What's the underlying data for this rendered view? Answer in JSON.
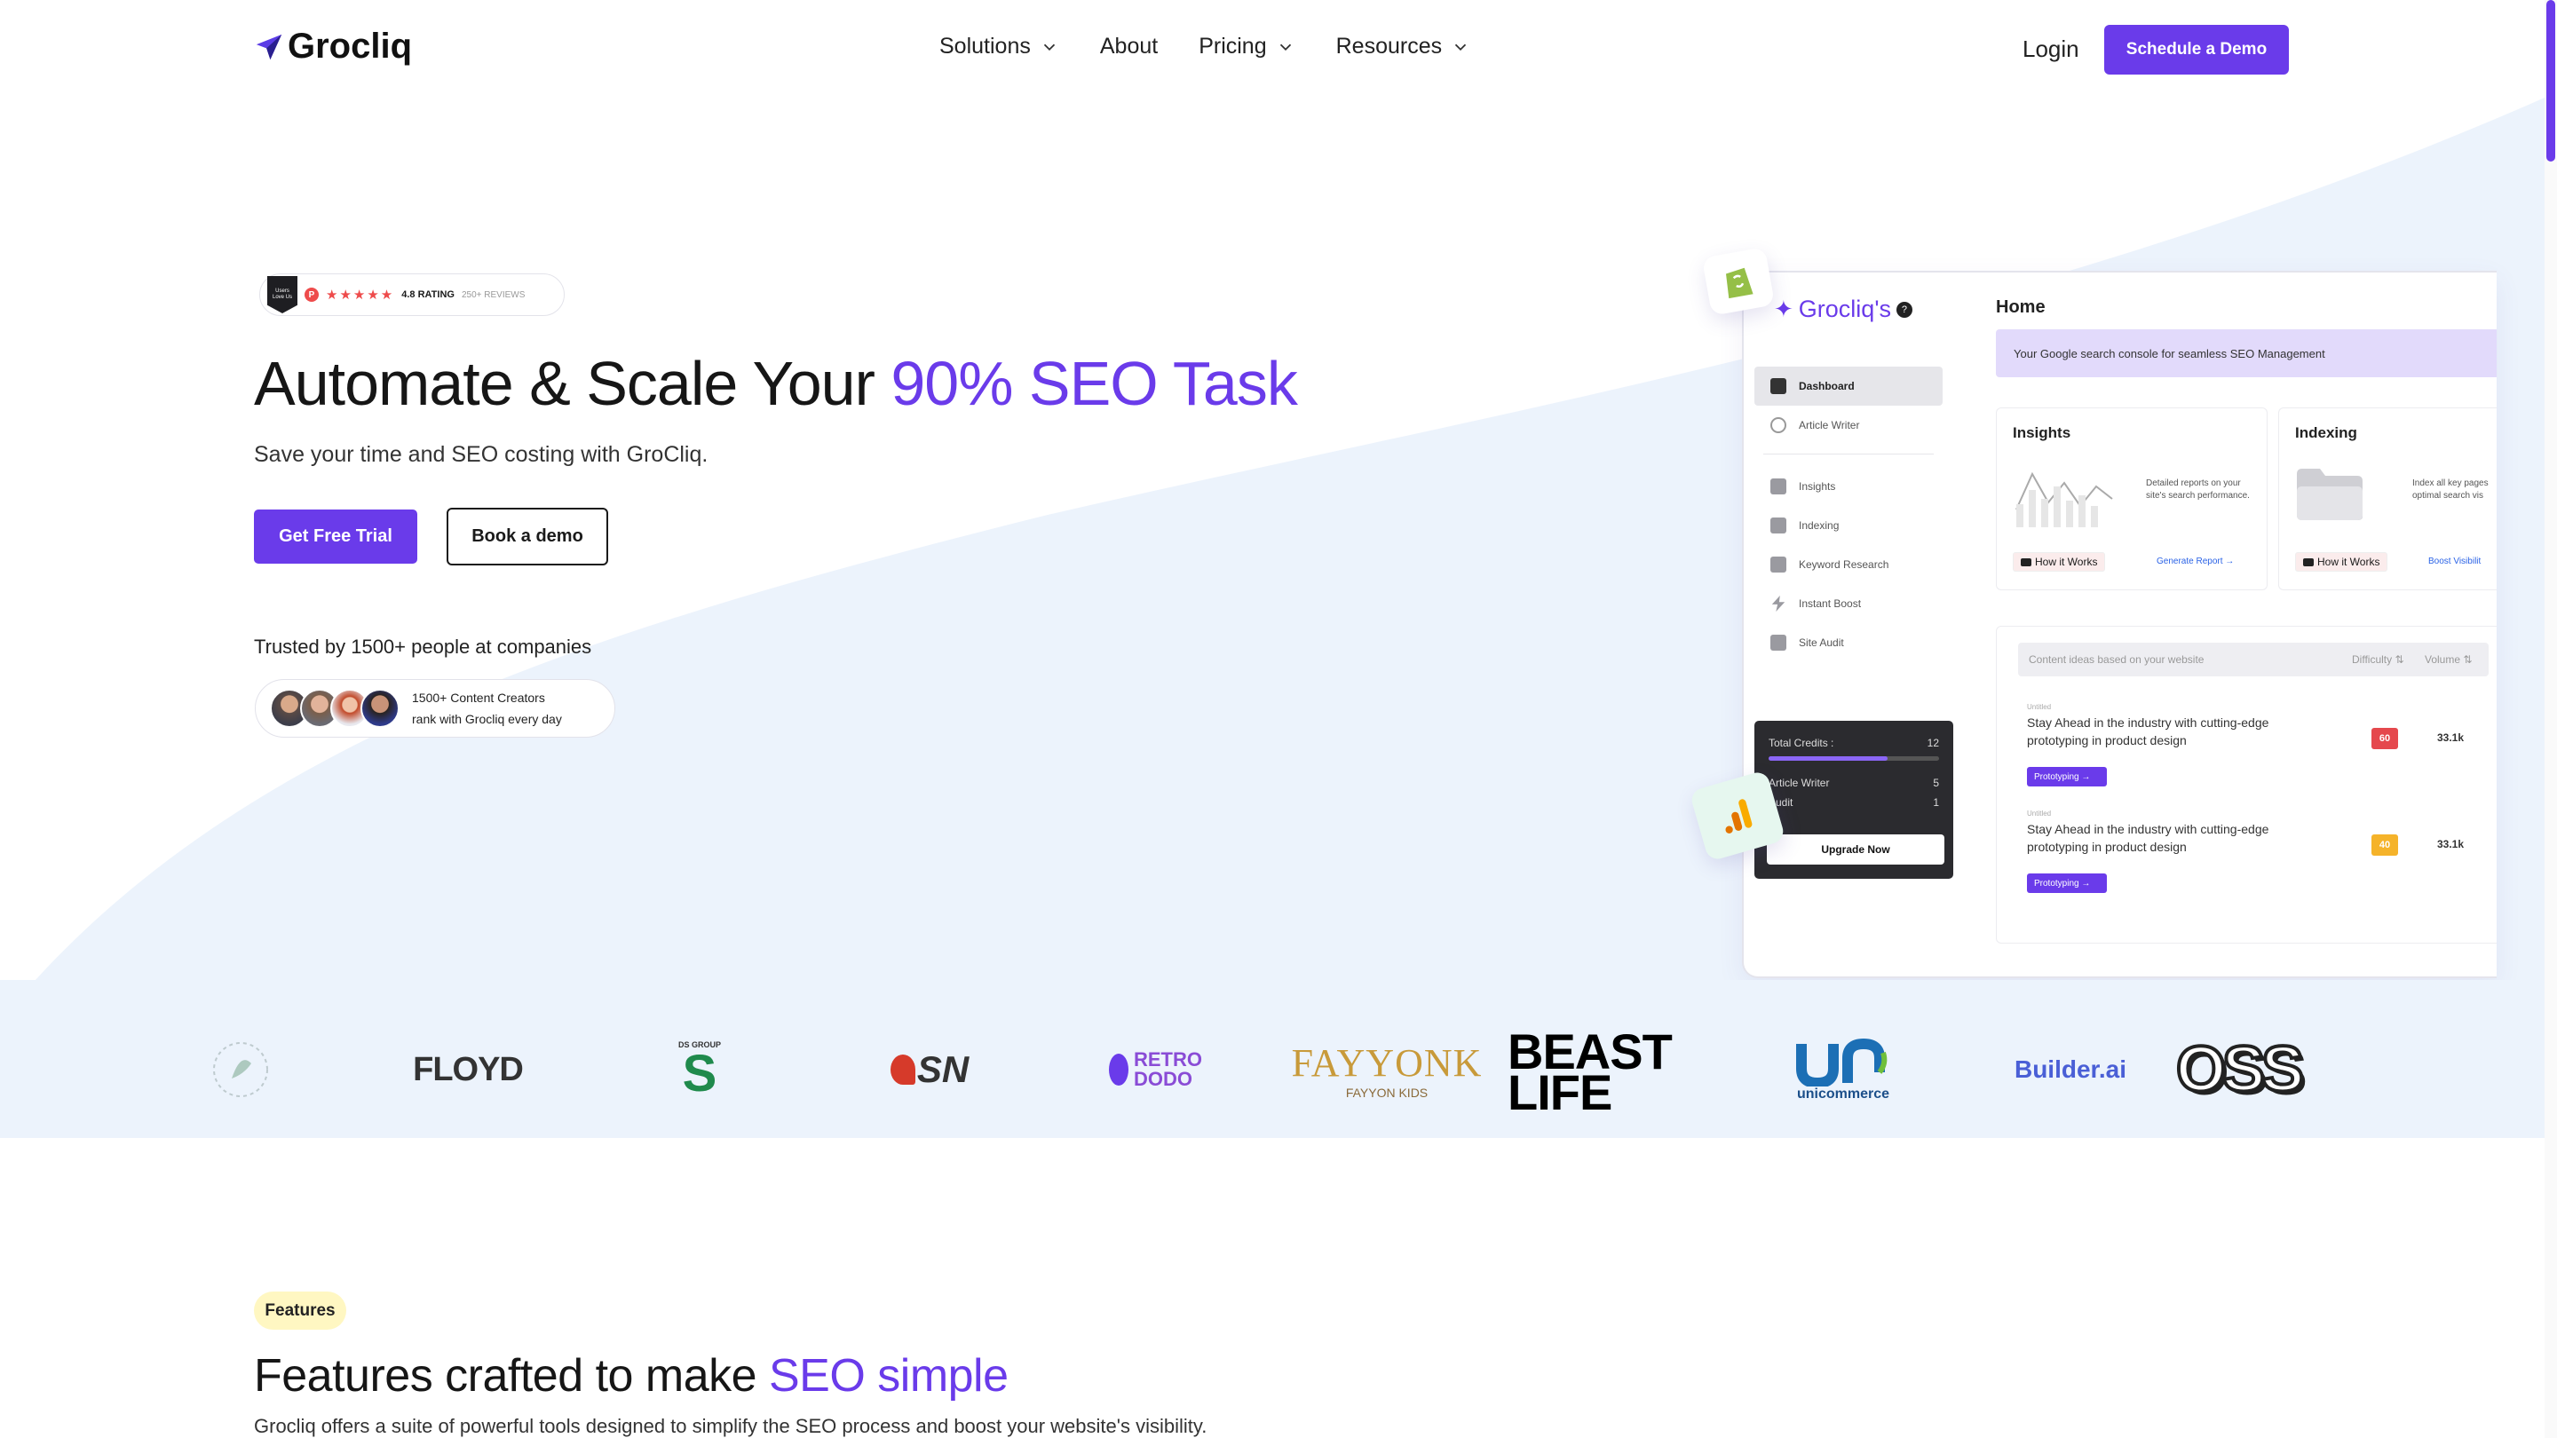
{
  "brand": {
    "name": "Grocliq",
    "accent": "#6a3bea"
  },
  "nav": {
    "items": [
      {
        "label": "Solutions",
        "dropdown": true
      },
      {
        "label": "About",
        "dropdown": false
      },
      {
        "label": "Pricing",
        "dropdown": true
      },
      {
        "label": "Resources",
        "dropdown": true
      }
    ],
    "login": "Login",
    "cta": "Schedule a Demo"
  },
  "hero": {
    "badge": {
      "shield_text": "Users Love Us",
      "rating": "4.8 RATING",
      "reviews": "250+ REVIEWS"
    },
    "title_prefix": "Automate & Scale Your ",
    "title_accent": "90% SEO Task",
    "subtitle": "Save your time and SEO costing with GroCliq.",
    "primary_button": "Get Free Trial",
    "secondary_button": "Book a demo",
    "trusted": "Trusted by 1500+ people at companies",
    "creators_line1": "1500+ Content Creators",
    "creators_line2": "rank with Grocliq every day"
  },
  "dashboard": {
    "logo": "Grocliq's",
    "sidebar": {
      "primary": [
        "Dashboard",
        "Article Writer"
      ],
      "secondary": [
        "Insights",
        "Indexing",
        "Keyword Research",
        "Instant Boost",
        "Site Audit"
      ]
    },
    "credits": {
      "label": "Total Credits :",
      "total": "12",
      "rows": [
        {
          "label": "Article Writer",
          "value": "5"
        },
        {
          "label": "Audit",
          "value": "1"
        }
      ],
      "button": "Upgrade Now"
    },
    "home": "Home",
    "banner": "Your Google search console for seamless SEO Management",
    "cards": [
      {
        "title": "Insights",
        "desc": "Detailed reports on your site's search performance.",
        "how": "How it Works",
        "action": "Generate Report →"
      },
      {
        "title": "Indexing",
        "desc": "Index all key pages optimal search vis",
        "how": "How it Works",
        "action": "Boost Visibilit"
      }
    ],
    "table": {
      "header": "Content ideas based on your website",
      "difficulty": "Difficulty ⇅",
      "volume": "Volume ⇅",
      "rows": [
        {
          "small": "Untitled",
          "title": "Stay Ahead in the industry with cutting-edge prototyping in product design",
          "tag": "Prototyping →",
          "difficulty": "60",
          "difficulty_color": "#e5484d",
          "volume": "33.1k"
        },
        {
          "small": "Untitled",
          "title": "Stay Ahead in the industry with cutting-edge prototyping in product design",
          "tag": "Prototyping →",
          "difficulty": "40",
          "difficulty_color": "#f5b32a",
          "volume": "33.1k"
        }
      ]
    }
  },
  "logos": [
    "FLOYD",
    "DS GROUP",
    "SN",
    "RETRO DODO",
    "FAYYONK",
    "FAYYON KIDS",
    "BEAST LIFE",
    "unicommerce",
    "Builder.ai",
    "OSS"
  ],
  "features": {
    "badge": "Features",
    "title_prefix": "Features crafted to make ",
    "title_accent": "SEO simple",
    "subtitle": "Grocliq offers a suite of powerful tools designed to simplify the SEO process and boost your website's visibility."
  }
}
